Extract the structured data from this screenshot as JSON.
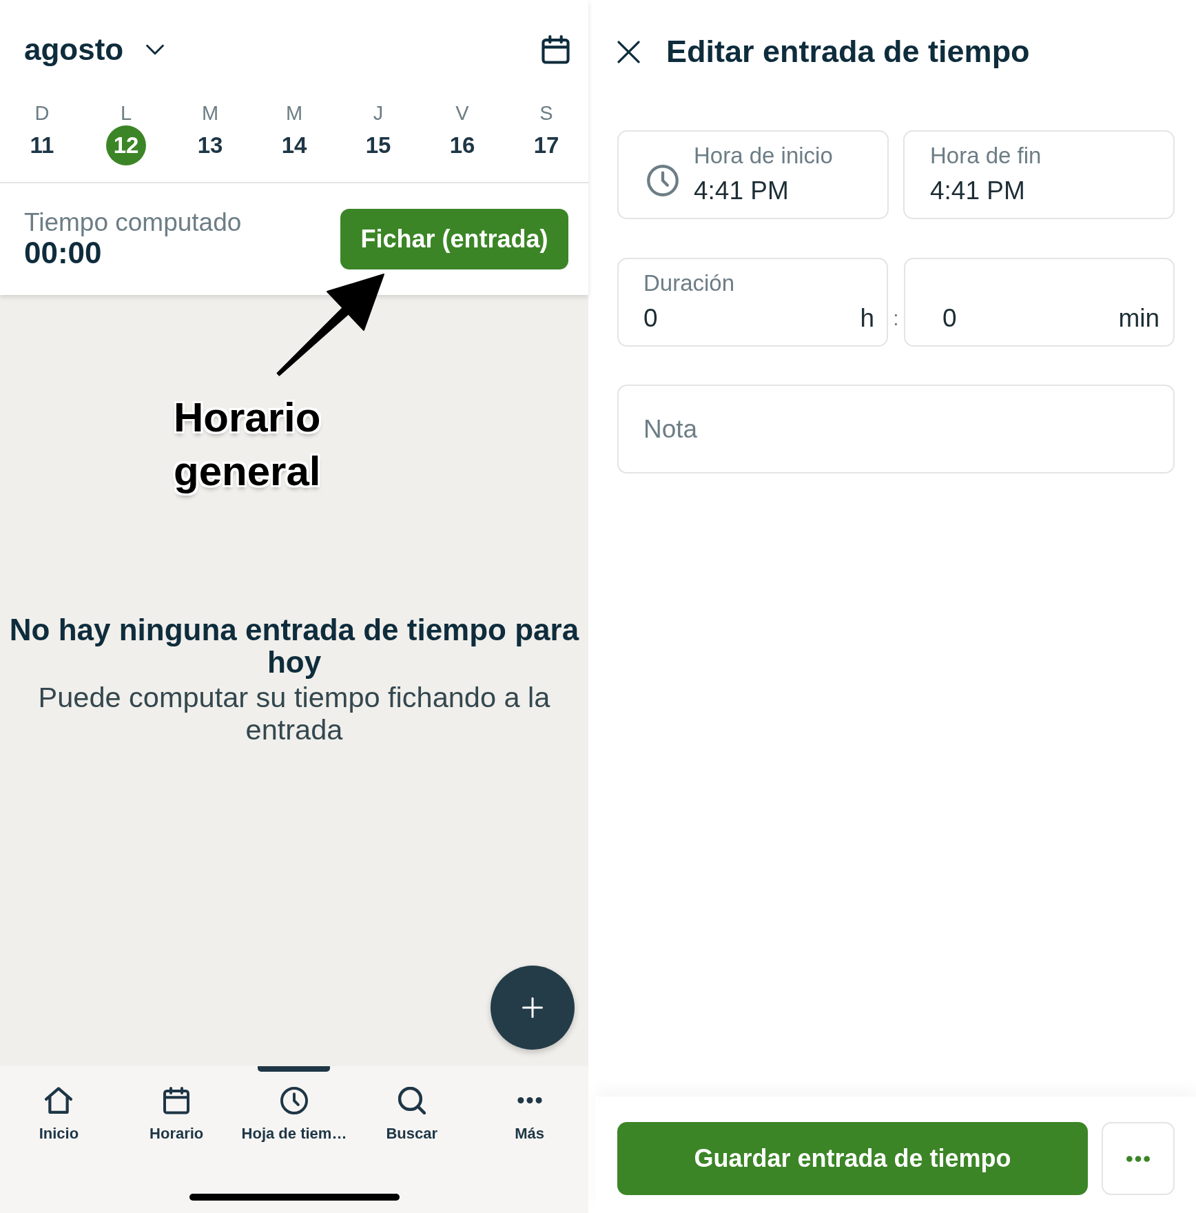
{
  "month_header": {
    "month": "agosto"
  },
  "week": [
    {
      "weekday": "D",
      "day": "11",
      "selected": false
    },
    {
      "weekday": "L",
      "day": "12",
      "selected": true
    },
    {
      "weekday": "M",
      "day": "13",
      "selected": false
    },
    {
      "weekday": "M",
      "day": "14",
      "selected": false
    },
    {
      "weekday": "J",
      "day": "15",
      "selected": false
    },
    {
      "weekday": "V",
      "day": "16",
      "selected": false
    },
    {
      "weekday": "S",
      "day": "17",
      "selected": false
    }
  ],
  "summary": {
    "label": "Tiempo computado",
    "value": "00:00",
    "clock_in_button": "Fichar (entrada)"
  },
  "empty_state": {
    "title": "No hay ninguna entrada de tiempo para hoy",
    "message": "Puede computar su tiempo fichando a la entrada"
  },
  "annotation": {
    "text": "Horario general"
  },
  "bottom_nav": [
    {
      "kind": "home",
      "label": "Inicio",
      "selected": false
    },
    {
      "kind": "calendar",
      "label": "Horario",
      "selected": false
    },
    {
      "kind": "clock",
      "label": "Hoja de tiem…",
      "selected": true
    },
    {
      "kind": "search",
      "label": "Buscar",
      "selected": false
    },
    {
      "kind": "more",
      "label": "Más",
      "selected": false
    }
  ],
  "edit_panel": {
    "title": "Editar entrada de tiempo",
    "time_fields": [
      {
        "kind": "clock",
        "label": "Hora de inicio",
        "value": "4:41 PM"
      },
      {
        "kind": "plain",
        "label": "Hora de fin",
        "value": "4:41 PM"
      }
    ],
    "duration": {
      "label": "Duración",
      "hours": "0",
      "hours_unit": "h",
      "separator": ":",
      "minutes": "0",
      "minutes_unit": "min"
    },
    "note": {
      "placeholder": "Nota"
    },
    "save_button": "Guardar entrada de tiempo"
  }
}
